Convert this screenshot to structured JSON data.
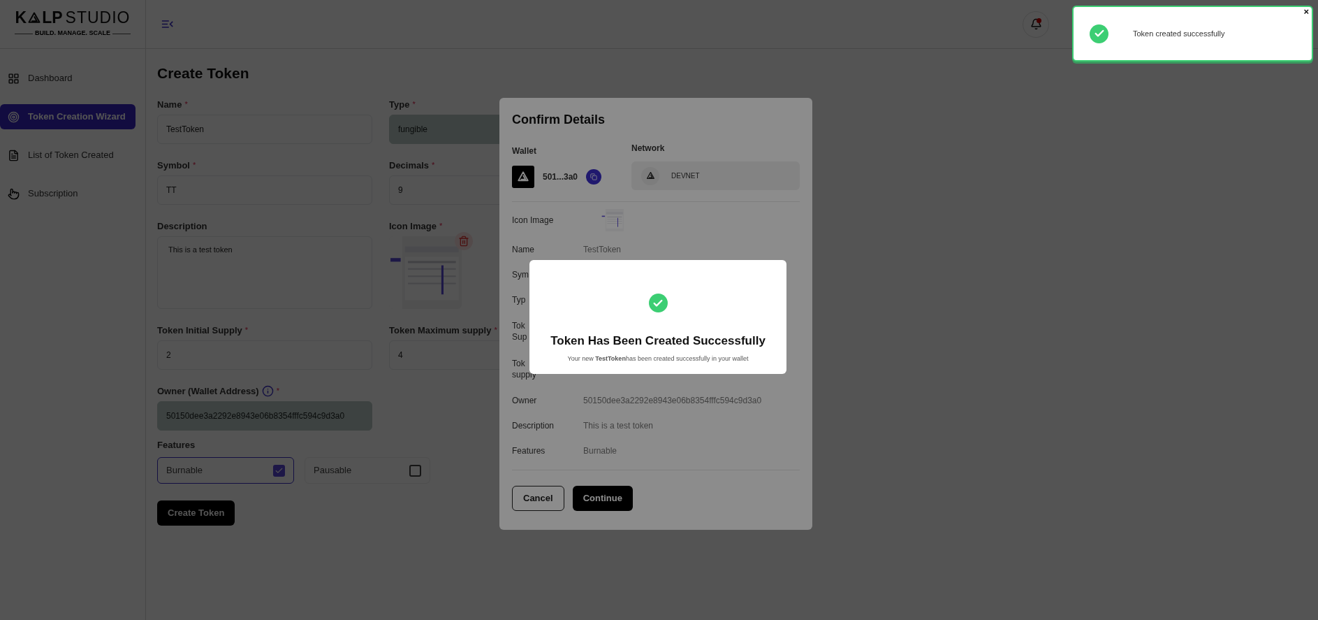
{
  "brand": {
    "first": "K",
    "second": "LP",
    "studio": "STUDIO",
    "tagline": "BUILD. MANAGE. SCALE"
  },
  "sidebar": {
    "items": [
      {
        "label": "Dashboard",
        "selected": false
      },
      {
        "label": "Token Creation Wizard",
        "selected": true
      },
      {
        "label": "List of Token Created",
        "selected": false
      },
      {
        "label": "Subscription",
        "selected": false
      }
    ]
  },
  "header": {
    "notification_dot": true
  },
  "page": {
    "title": "Create Token",
    "fields": [
      {
        "kind": "text",
        "label": "Name",
        "mark": "*",
        "value": "TestToken",
        "disabled": false
      },
      {
        "kind": "text",
        "label": "Type",
        "mark": "*",
        "value": "fungible",
        "disabled": true
      },
      {
        "kind": "text",
        "label": "Symbol",
        "mark": "*",
        "value": "TT",
        "disabled": false
      },
      {
        "kind": "text",
        "label": "Decimals",
        "mark": "*",
        "value": "9",
        "disabled": false
      },
      {
        "kind": "textarea",
        "label": "Description",
        "value": "This is a test token",
        "disabled": false
      },
      {
        "label": "Icon Image",
        "mark": "*"
      },
      {
        "kind": "text",
        "label": "Token Initial Supply",
        "mark": "*",
        "value": "2",
        "disabled": false
      },
      {
        "kind": "text",
        "label": "Token Maximum supply",
        "mark": "*",
        "value": "4",
        "disabled": false
      },
      {
        "kind": "text",
        "label": "Owner (Wallet Address)",
        "mark": "*",
        "info": true,
        "value": "50150dee3a2292e8943e06b8354fffc594c9d3a0",
        "disabled": true
      }
    ],
    "features": {
      "label": "Features",
      "options": [
        {
          "label": "Burnable",
          "checked": true
        },
        {
          "label": "Pausable",
          "checked": false
        }
      ]
    },
    "submit": "Create Token"
  },
  "confirm": {
    "title": "Confirm Details",
    "wallet_label": "Wallet",
    "wallet": "501...3a0",
    "network_label": "Network",
    "network": "DEVNET",
    "icon_label": "Icon Image",
    "rows": [
      {
        "label": [
          "Name"
        ],
        "value": "TestToken"
      },
      {
        "label": [
          "Sym"
        ]
      },
      {
        "label": [
          "Typ"
        ]
      },
      {
        "label": [
          "Tok",
          "Sup"
        ]
      },
      {
        "label": [
          "Tok",
          "supply"
        ]
      },
      {
        "label": [
          "Owner"
        ],
        "value": "50150dee3a2292e8943e06b8354fffc594c9d3a0"
      },
      {
        "label": [
          "Description"
        ],
        "value": "This is a test token"
      },
      {
        "label": [
          "Features"
        ],
        "value": "Burnable"
      }
    ],
    "buttons": [
      {
        "kind": "outline",
        "label": "Cancel"
      },
      {
        "kind": "solid",
        "label": "Continue"
      }
    ]
  },
  "success": {
    "title": "Token Has Been Created Successfully",
    "message": "Your new **TestToken**has been created successfully in your wallet"
  },
  "toast": {
    "message": "Token created successfully",
    "close": "×"
  }
}
